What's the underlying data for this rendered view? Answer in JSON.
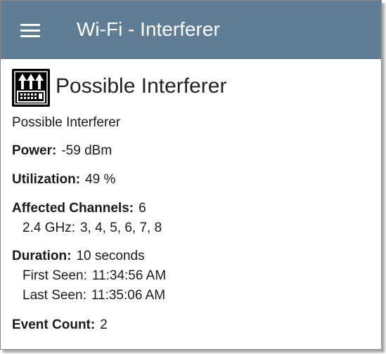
{
  "appbar": {
    "title": "Wi-Fi - Interferer",
    "menu_icon": "hamburger-menu-icon",
    "background": "#5f7d95"
  },
  "device": {
    "icon": "interferer-device-icon",
    "title": "Possible Interferer",
    "subtitle": "Possible Interferer"
  },
  "details": {
    "power_label": "Power:",
    "power_value": "-59 dBm",
    "utilization_label": "Utilization:",
    "utilization_value": "49 %",
    "affected_channels_label": "Affected Channels:",
    "affected_channels_value": "6",
    "band_label": "2.4 GHz:",
    "band_value": "3, 4, 5, 6, 7, 8",
    "duration_label": "Duration:",
    "duration_value": "10 seconds",
    "first_seen_label": "First Seen:",
    "first_seen_value": "11:34:56 AM",
    "last_seen_label": "Last Seen:",
    "last_seen_value": "11:35:06 AM",
    "event_count_label": "Event Count:",
    "event_count_value": "2"
  }
}
